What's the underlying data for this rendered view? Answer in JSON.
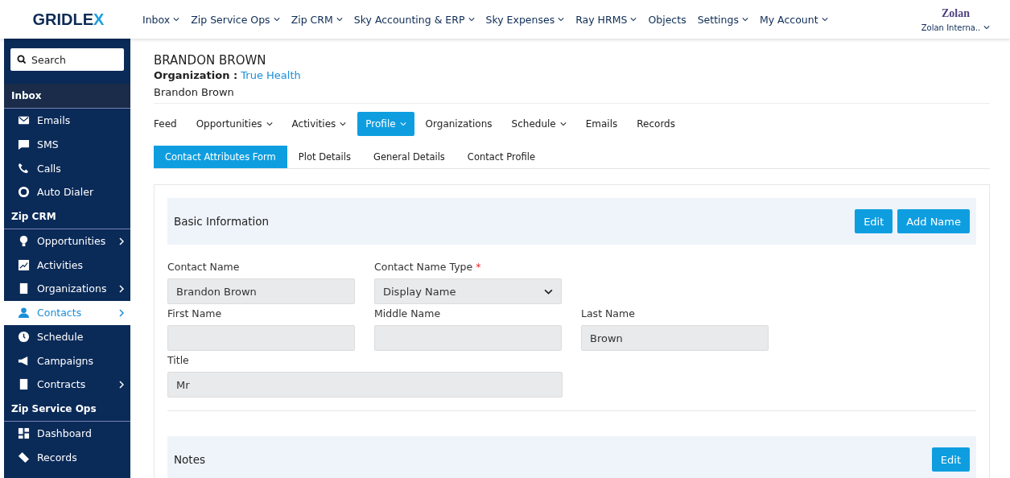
{
  "logo": {
    "text": "GRIDLE",
    "accent": "X"
  },
  "top_nav": [
    {
      "label": "Inbox",
      "dropdown": true
    },
    {
      "label": "Zip Service Ops",
      "dropdown": true
    },
    {
      "label": "Zip CRM",
      "dropdown": true
    },
    {
      "label": "Sky Accounting & ERP",
      "dropdown": true
    },
    {
      "label": "Sky Expenses",
      "dropdown": true
    },
    {
      "label": "Ray HRMS",
      "dropdown": true
    },
    {
      "label": "Objects",
      "dropdown": false
    },
    {
      "label": "Settings",
      "dropdown": true
    },
    {
      "label": "My Account",
      "dropdown": true
    }
  ],
  "account": {
    "brand": "Zolan",
    "company": "Zolan Interna.."
  },
  "sidebar": {
    "search_placeholder": "Search",
    "sections": [
      {
        "title": "Inbox",
        "items": [
          {
            "label": "Emails",
            "submenu": false,
            "selected": false
          },
          {
            "label": "SMS",
            "submenu": false,
            "selected": false
          },
          {
            "label": "Calls",
            "submenu": false,
            "selected": false
          },
          {
            "label": "Auto Dialer",
            "submenu": false,
            "selected": false
          }
        ]
      },
      {
        "title": "Zip CRM",
        "items": [
          {
            "label": "Opportunities",
            "submenu": true,
            "selected": false
          },
          {
            "label": "Activities",
            "submenu": false,
            "selected": false
          },
          {
            "label": "Organizations",
            "submenu": true,
            "selected": false
          },
          {
            "label": "Contacts",
            "submenu": true,
            "selected": true
          },
          {
            "label": "Schedule",
            "submenu": false,
            "selected": false
          },
          {
            "label": "Campaigns",
            "submenu": false,
            "selected": false
          },
          {
            "label": "Contracts",
            "submenu": true,
            "selected": false
          }
        ]
      },
      {
        "title": "Zip Service Ops",
        "items": [
          {
            "label": "Dashboard",
            "submenu": false,
            "selected": false
          },
          {
            "label": "Records",
            "submenu": false,
            "selected": false
          }
        ]
      }
    ]
  },
  "contact": {
    "name": "BRANDON BROWN",
    "organization_label": "Organization :",
    "organization": "True Health",
    "display_name": "Brandon Brown"
  },
  "tabs": [
    {
      "label": "Feed",
      "dropdown": false,
      "selected": false
    },
    {
      "label": "Opportunities",
      "dropdown": true,
      "selected": false
    },
    {
      "label": "Activities",
      "dropdown": true,
      "selected": false
    },
    {
      "label": "Profile",
      "dropdown": true,
      "selected": true
    },
    {
      "label": "Organizations",
      "dropdown": false,
      "selected": false
    },
    {
      "label": "Schedule",
      "dropdown": true,
      "selected": false
    },
    {
      "label": "Emails",
      "dropdown": false,
      "selected": false
    },
    {
      "label": "Records",
      "dropdown": false,
      "selected": false
    }
  ],
  "subtabs": [
    {
      "label": "Contact Attributes Form",
      "selected": true
    },
    {
      "label": "Plot Details",
      "selected": false
    },
    {
      "label": "General Details",
      "selected": false
    },
    {
      "label": "Contact Profile",
      "selected": false
    }
  ],
  "basic_information": {
    "title": "Basic Information",
    "buttons": [
      "Edit",
      "Add Name"
    ],
    "rows": [
      [
        {
          "label": "Contact Name",
          "kind": "text",
          "value": "Brandon Brown"
        },
        {
          "label": "Contact Name Type",
          "kind": "select",
          "value": "Display Name",
          "required_mark": "*"
        }
      ],
      [
        {
          "label": "First Name",
          "kind": "text"
        },
        {
          "label": "Middle Name",
          "kind": "text"
        },
        {
          "label": "Last Name",
          "kind": "text",
          "value": "Brown"
        }
      ],
      [
        {
          "label": "Title",
          "kind": "wide",
          "value": "Mr"
        }
      ]
    ]
  },
  "notes": {
    "title": "Notes",
    "buttons": [
      "Edit"
    ]
  }
}
